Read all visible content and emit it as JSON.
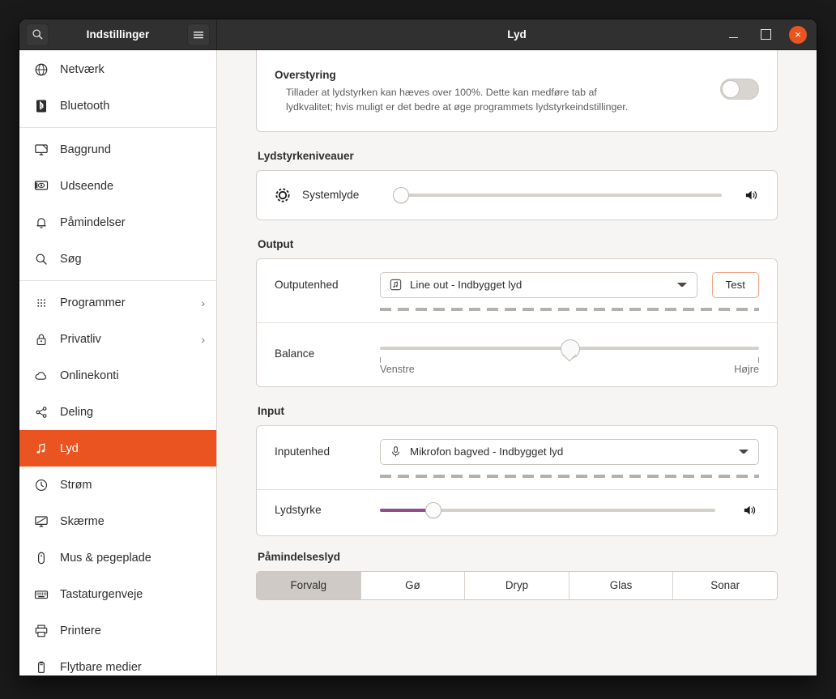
{
  "window": {
    "app_title": "Indstillinger",
    "page_title": "Lyd",
    "search_icon": "search-icon",
    "menu_icon": "hamburger-menu-icon",
    "minimize_label": "",
    "maximize_label": "",
    "close_label": "×",
    "accent_color": "#e95420"
  },
  "sidebar": {
    "items": [
      {
        "label": "Netværk",
        "icon": "network-globe-icon",
        "chevron": "",
        "selected": false,
        "sep_after": false
      },
      {
        "label": "Bluetooth",
        "icon": "bluetooth-icon",
        "chevron": "",
        "selected": false,
        "sep_after": true
      },
      {
        "label": "Baggrund",
        "icon": "wallpaper-icon",
        "chevron": "",
        "selected": false,
        "sep_after": false
      },
      {
        "label": "Udseende",
        "icon": "appearance-icon",
        "chevron": "",
        "selected": false,
        "sep_after": false
      },
      {
        "label": "Påmindelser",
        "icon": "bell-icon",
        "chevron": "",
        "selected": false,
        "sep_after": false
      },
      {
        "label": "Søg",
        "icon": "search-icon",
        "chevron": "",
        "selected": false,
        "sep_after": true
      },
      {
        "label": "Programmer",
        "icon": "apps-grid-icon",
        "chevron": "›",
        "selected": false,
        "sep_after": false
      },
      {
        "label": "Privatliv",
        "icon": "lock-icon",
        "chevron": "›",
        "selected": false,
        "sep_after": false
      },
      {
        "label": "Onlinekonti",
        "icon": "cloud-icon",
        "chevron": "",
        "selected": false,
        "sep_after": false
      },
      {
        "label": "Deling",
        "icon": "share-icon",
        "chevron": "",
        "selected": false,
        "sep_after": false
      },
      {
        "label": "Lyd",
        "icon": "sound-note-icon",
        "chevron": "",
        "selected": true,
        "sep_after": false
      },
      {
        "label": "Strøm",
        "icon": "power-icon",
        "chevron": "",
        "selected": false,
        "sep_after": false
      },
      {
        "label": "Skærme",
        "icon": "displays-icon",
        "chevron": "",
        "selected": false,
        "sep_after": false
      },
      {
        "label": "Mus & pegeplade",
        "icon": "mouse-icon",
        "chevron": "",
        "selected": false,
        "sep_after": false
      },
      {
        "label": "Tastaturgenveje",
        "icon": "keyboard-icon",
        "chevron": "",
        "selected": false,
        "sep_after": false
      },
      {
        "label": "Printere",
        "icon": "printer-icon",
        "chevron": "",
        "selected": false,
        "sep_after": false
      },
      {
        "label": "Flytbare medier",
        "icon": "removable-media-icon",
        "chevron": "",
        "selected": false,
        "sep_after": false
      }
    ]
  },
  "main": {
    "overdrive": {
      "title": "Overstyring",
      "description": "Tillader at lydstyrken kan hæves over 100%. Dette kan medføre tab af lydkvalitet; hvis muligt er det bedre at øge programmets lydstyrkeindstillinger.",
      "toggle_state": "off"
    },
    "volume_levels": {
      "section_title": "Lydstyrkeniveauer",
      "app_label": "Systemlyde",
      "app_icon": "system-sounds-gear-icon",
      "value_percent": 0,
      "speaker_icon": "speaker-volume-icon"
    },
    "output": {
      "section_title": "Output",
      "device_label": "Outputenhed",
      "device_value": "Line out - Indbygget lyd",
      "device_icon": "audio-note-icon",
      "test_label": "Test",
      "balance_label": "Balance",
      "balance_left_label": "Venstre",
      "balance_right_label": "Højre",
      "balance_percent": 50
    },
    "input": {
      "section_title": "Input",
      "device_label": "Inputenhed",
      "device_value": "Mikrofon bagved - Indbygget lyd",
      "device_icon": "microphone-icon",
      "volume_label": "Lydstyrke",
      "volume_percent": 16,
      "speaker_icon": "speaker-volume-icon",
      "fill_color": "#924c8e"
    },
    "alert_sound": {
      "section_title": "Påmindelseslyd",
      "options": [
        {
          "label": "Forvalg",
          "active": true
        },
        {
          "label": "Gø",
          "active": false
        },
        {
          "label": "Dryp",
          "active": false
        },
        {
          "label": "Glas",
          "active": false
        },
        {
          "label": "Sonar",
          "active": false
        }
      ]
    }
  }
}
